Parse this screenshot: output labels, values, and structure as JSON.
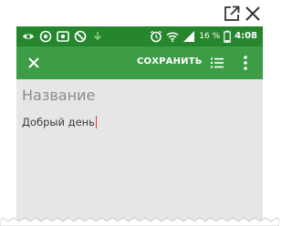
{
  "colors": {
    "status_bar": "#26862e",
    "app_bar": "#3d9c46",
    "note_background": "#e6e6e6",
    "cursor": "#e53935"
  },
  "outer_toolbar": {
    "icons": [
      "external-link-icon",
      "close-window-icon"
    ]
  },
  "status_bar": {
    "left_icons": [
      "eye-icon",
      "wifi-ring-icon",
      "screen-record-icon",
      "do-not-disturb-icon",
      "download-icon"
    ],
    "right_icons": [
      "alarm-icon",
      "wifi-icon",
      "signal-icon"
    ],
    "battery_percent": "16 %",
    "battery_level": 0.16,
    "time": "4:08"
  },
  "app_bar": {
    "close_icon": "close-icon",
    "save_label": "СОХРАНИТЬ",
    "list_icon": "checklist-icon",
    "more_icon": "more-vertical-icon"
  },
  "note": {
    "title_placeholder": "Название",
    "body_text": "Добрый день"
  }
}
